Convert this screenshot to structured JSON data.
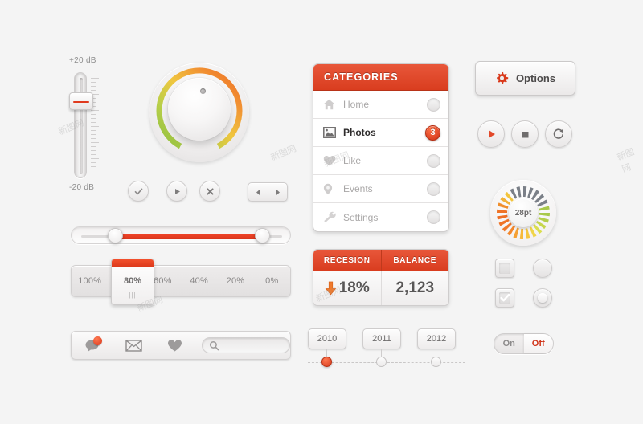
{
  "fader": {
    "top_label": "+20 dB",
    "bottom_label": "-20 dB",
    "name": "volume-fader"
  },
  "knob": {
    "name": "rotary-knob",
    "arc_start_color": "#a8c94a",
    "arc_mid_color": "#f0c040",
    "arc_end_color": "#ef7326"
  },
  "round_buttons": [
    {
      "name": "confirm-button",
      "icon": "check-icon"
    },
    {
      "name": "play-button",
      "icon": "play-icon"
    },
    {
      "name": "close-button",
      "icon": "close-icon"
    }
  ],
  "pager": {
    "prev": {
      "name": "prev-button",
      "icon": "caret-left-icon"
    },
    "next": {
      "name": "next-button",
      "icon": "caret-right-icon"
    }
  },
  "range_slider": {
    "name": "range-slider",
    "left_handle_pct": 18,
    "right_handle_pct": 88,
    "fill_color": "#e8391c"
  },
  "percent_selector": {
    "options": [
      "100%",
      "80%",
      "60%",
      "40%",
      "20%",
      "0%"
    ],
    "selected": "80%",
    "grip": "|||",
    "accent": "#e8451f"
  },
  "toolbar": {
    "chat": {
      "label": "chat-icon",
      "has_badge": true
    },
    "mail": {
      "label": "mail-icon"
    },
    "like": {
      "label": "heart-icon"
    },
    "search": {
      "placeholder": "",
      "value": "",
      "icon": "search-icon"
    }
  },
  "categories": {
    "title": "CATEGORIES",
    "header_color": "#dd4425",
    "items": [
      {
        "label": "Home",
        "icon": "home-icon",
        "active": false,
        "badge": null
      },
      {
        "label": "Photos",
        "icon": "photo-icon",
        "active": true,
        "badge": "3"
      },
      {
        "label": "Like",
        "icon": "heart-icon",
        "active": false,
        "badge": null
      },
      {
        "label": "Events",
        "icon": "location-icon",
        "active": false,
        "badge": null
      },
      {
        "label": "Settings",
        "icon": "wrench-icon",
        "active": false,
        "badge": null
      }
    ]
  },
  "stats": {
    "columns": [
      "RECESION",
      "BALANCE"
    ],
    "values": [
      "18%",
      "2,123"
    ],
    "trend_icon": "arrow-down-icon",
    "trend_color": "#ef7326"
  },
  "options_button": {
    "label": "Options",
    "icon": "gear-icon",
    "icon_color": "#d9391b"
  },
  "transport": [
    {
      "name": "play-button",
      "icon": "play-icon"
    },
    {
      "name": "stop-button",
      "icon": "stop-icon"
    },
    {
      "name": "refresh-button",
      "icon": "refresh-icon"
    }
  ],
  "gauge": {
    "value_label": "28pt",
    "segments_total": 24,
    "segments_filled": 17,
    "colors": [
      "#a8c94a",
      "#f0c040",
      "#ef7326",
      "#7b8088"
    ]
  },
  "choice_controls": {
    "checkbox_unchecked": {
      "name": "checkbox-unchecked",
      "checked": false
    },
    "checkbox_checked": {
      "name": "checkbox-checked",
      "checked": true,
      "icon": "check-icon"
    },
    "radio_unselected": {
      "name": "radio-unselected",
      "selected": false
    },
    "radio_selected": {
      "name": "radio-selected",
      "selected": true
    }
  },
  "toggle": {
    "on_label": "On",
    "off_label": "Off",
    "state": "Off",
    "active_color": "#d0341a"
  },
  "timeline": {
    "items": [
      {
        "year": "2010",
        "active": true
      },
      {
        "year": "2011",
        "active": false
      },
      {
        "year": "2012",
        "active": false
      }
    ]
  },
  "watermarks": [
    "新图网",
    "新图网",
    "新图网",
    "新图网",
    "新图网",
    "新图网"
  ]
}
